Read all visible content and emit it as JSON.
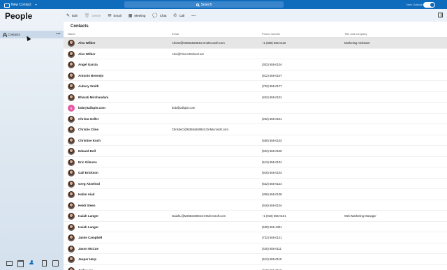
{
  "topbar": {
    "new_contact_label": "New Contact",
    "search_label": "Search",
    "new_outlook_label": "New Outlook",
    "toggle_on": true,
    "accent": "#0f6cbd"
  },
  "sidebar": {
    "app_title": "People",
    "selected_item": "Contacts",
    "bottom_nav": [
      "mail-icon",
      "calendar-icon",
      "people-icon",
      "tasks-icon",
      "notes-icon"
    ]
  },
  "toolbar": {
    "edit": "Edit",
    "delete": "Delete",
    "email": "Email",
    "meeting": "Meeting",
    "chat": "Chat",
    "call": "Call",
    "more": "•••"
  },
  "main": {
    "section_title": "Contacts",
    "columns": [
      "Name",
      "Email",
      "Phone number",
      "Title and company"
    ],
    "rows": [
      {
        "name": "Alex Wilber",
        "email": "AlexW@M365x550843.OnMicrosoft.com",
        "phone": "+1 (858) 555-0110",
        "title": "Marketing Assistant",
        "selected": true,
        "avatar": "photo"
      },
      {
        "name": "Alex Wilber",
        "email": "Alex@FineArtSchool.net",
        "phone": "",
        "title": "",
        "avatar": "photo"
      },
      {
        "name": "Angel Garcia",
        "email": "",
        "phone": "(302) 555-0104",
        "title": "",
        "avatar": "photo"
      },
      {
        "name": "Antonio Bermejo",
        "email": "",
        "phone": "(812) 555-0107",
        "title": "",
        "avatar": "photo"
      },
      {
        "name": "Aubury Smith",
        "email": "",
        "phone": "(732) 555-0177",
        "title": "",
        "avatar": "photo"
      },
      {
        "name": "Bharati Mirchandani",
        "email": "",
        "phone": "(402) 555-0101",
        "title": "",
        "avatar": "photo"
      },
      {
        "name": "bob@tailspin.com",
        "email": "bob@tailspin.com",
        "phone": "",
        "title": "",
        "avatar": "initial",
        "initial": "B"
      },
      {
        "name": "Christa Geller",
        "email": "",
        "phone": "(262) 555-0101",
        "title": "",
        "avatar": "photo"
      },
      {
        "name": "Christie Cline",
        "email": "ChristieC@M365x550843.OnMicrosoft.com",
        "phone": "",
        "title": "",
        "avatar": "photo"
      },
      {
        "name": "Christine Koch",
        "email": "",
        "phone": "(480) 555-0102",
        "title": "",
        "avatar": "photo"
      },
      {
        "name": "Eduard Dell",
        "email": "",
        "phone": "(502) 555-0106",
        "title": "",
        "avatar": "photo"
      },
      {
        "name": "Eric Gilmore",
        "email": "",
        "phone": "(513) 555-0101",
        "title": "",
        "avatar": "photo"
      },
      {
        "name": "Gail Erickson",
        "email": "",
        "phone": "(916) 555-0102",
        "title": "",
        "avatar": "photo"
      },
      {
        "name": "Greg Akselrod",
        "email": "",
        "phone": "(622) 555-0124",
        "title": "",
        "avatar": "photo"
      },
      {
        "name": "Hatim Aiad",
        "email": "",
        "phone": "(309) 555-0108",
        "title": "",
        "avatar": "photo"
      },
      {
        "name": "Heidi Steen",
        "email": "",
        "phone": "(916) 555-0104",
        "title": "",
        "avatar": "photo"
      },
      {
        "name": "Isaiah Langer",
        "email": "IsaiahL@M365x550843.OnMicrosoft.com",
        "phone": "+1 (918) 555-0101",
        "title": "Web Marketing Manager",
        "avatar": "photo"
      },
      {
        "name": "Isaiah Langer",
        "email": "",
        "phone": "(539) 555-4321",
        "title": "",
        "avatar": "photo"
      },
      {
        "name": "Jamie Campbell",
        "email": "",
        "phone": "(732) 555-0121",
        "title": "",
        "avatar": "photo"
      },
      {
        "name": "Jason McCue",
        "email": "",
        "phone": "(425) 555-0111",
        "title": "",
        "avatar": "photo"
      },
      {
        "name": "Jesper Herp",
        "email": "",
        "phone": "(612) 555-0119",
        "title": "",
        "avatar": "photo"
      },
      {
        "name": "Judy Lew",
        "email": "",
        "phone": "(410) 555-0110",
        "title": "",
        "avatar": "photo"
      }
    ]
  }
}
